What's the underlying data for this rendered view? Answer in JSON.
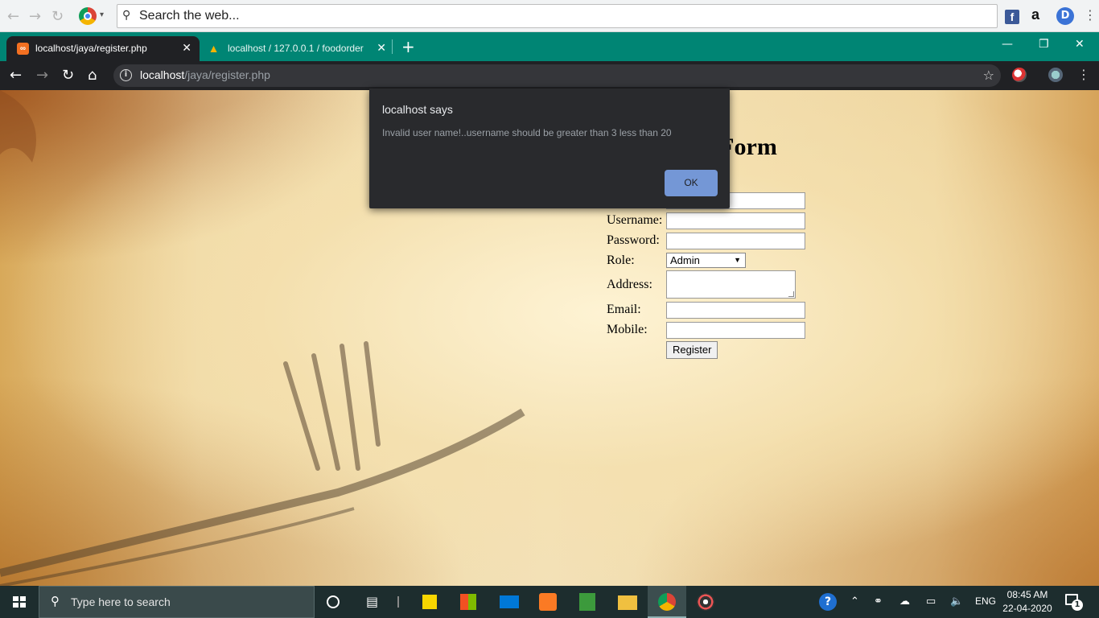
{
  "toolbar": {
    "search_placeholder": "Search the web...",
    "search_engines": [
      "facebook",
      "amazon",
      "duckduckgo"
    ]
  },
  "tabs": [
    {
      "title": "localhost/jaya/register.php",
      "active": true
    },
    {
      "title": "localhost / 127.0.0.1 / foodorder",
      "active": false
    }
  ],
  "address": {
    "host": "localhost",
    "path": "/jaya/register.php"
  },
  "page": {
    "form_title_visible": "n Form",
    "fields": [
      {
        "label": "Username:"
      },
      {
        "label": "Password:"
      },
      {
        "label": "Role:",
        "select_value": "Admin"
      },
      {
        "label": "Address:"
      },
      {
        "label": "Email:"
      },
      {
        "label": "Mobile:"
      }
    ],
    "register_label": "Register"
  },
  "dialog": {
    "title": "localhost says",
    "message": "Invalid user name!..username should be greater than 3 less than 20",
    "ok_label": "OK",
    "button_color": "#7497d6"
  },
  "taskbar": {
    "search_placeholder": "Type here to search",
    "language": "ENG",
    "time": "08:45 AM",
    "date": "22-04-2020",
    "notification_count": "1"
  },
  "colors": {
    "tabstrip": "#008574",
    "addressbar": "#202124",
    "taskbar": "#1d2d2e"
  }
}
